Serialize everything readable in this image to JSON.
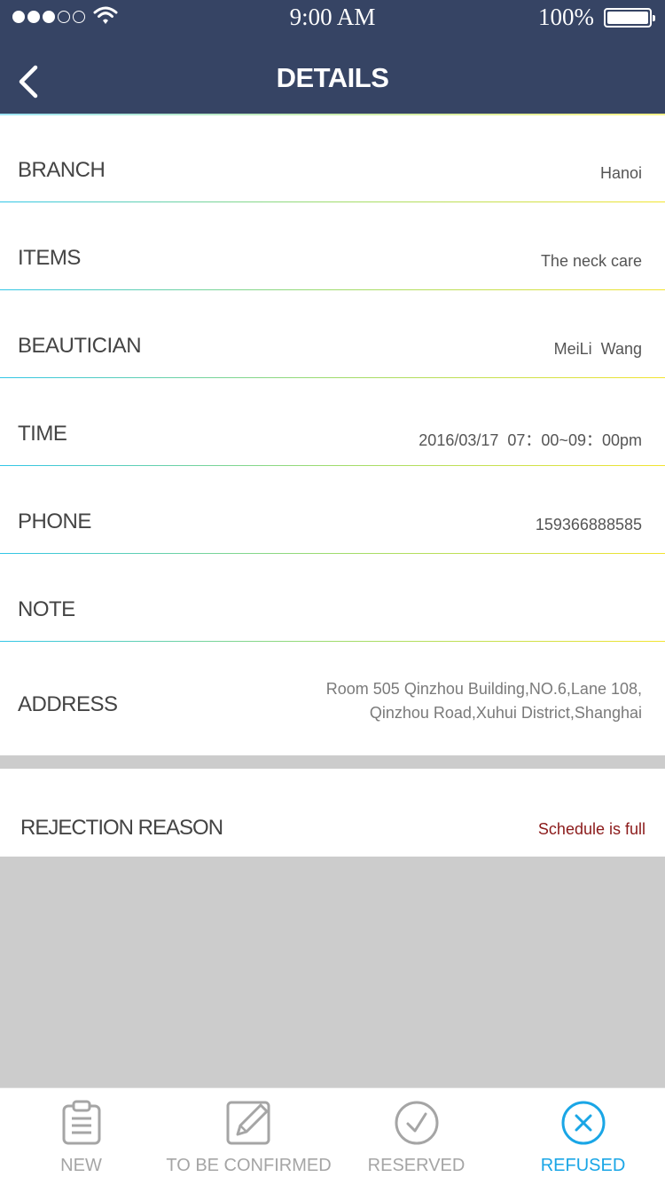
{
  "status_bar": {
    "time": "9:00 AM",
    "battery": "100%"
  },
  "nav": {
    "title": "DETAILS"
  },
  "details": [
    {
      "label": "BRANCH",
      "value": "Hanoi"
    },
    {
      "label": "ITEMS",
      "value": "The neck care"
    },
    {
      "label": "BEAUTICIAN",
      "value": "MeiLi  Wang"
    },
    {
      "label": "TIME",
      "value": "2016/03/17  07：00~09：00pm"
    },
    {
      "label": "PHONE",
      "value": "159366888585"
    },
    {
      "label": "NOTE",
      "value": ""
    }
  ],
  "address": {
    "label": "ADDRESS",
    "line1": "Room 505 Qinzhou Building,NO.6,Lane 108,",
    "line2": "Qinzhou Road,Xuhui District,Shanghai"
  },
  "rejection": {
    "label": "REJECTION REASON",
    "value": "Schedule is full",
    "color": "#8b1a1a"
  },
  "tabs": [
    {
      "label": "NEW",
      "icon": "clipboard-icon",
      "active": false
    },
    {
      "label": "TO BE CONFIRMED",
      "icon": "edit-icon",
      "active": false
    },
    {
      "label": "RESERVED",
      "icon": "check-circle-icon",
      "active": false
    },
    {
      "label": "REFUSED",
      "icon": "close-circle-icon",
      "active": true
    }
  ],
  "colors": {
    "header": "#364464",
    "active_tab": "#1aa6e6",
    "inactive_tab": "#a5a5a5"
  }
}
